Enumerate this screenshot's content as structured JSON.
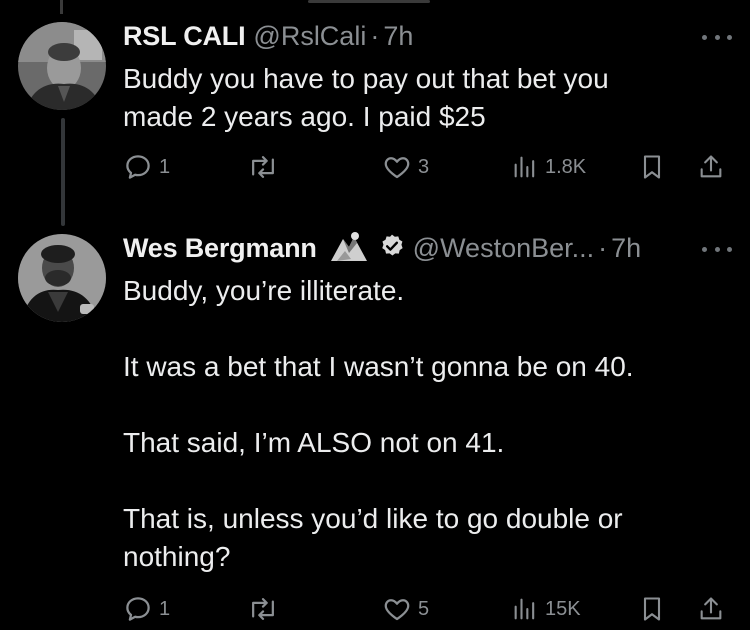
{
  "tweets": [
    {
      "name": "RSL CALI",
      "handle": "@RslCali",
      "separator": "·",
      "time": "7h",
      "text_lines": [
        "Buddy you have to pay out that bet you",
        "made 2 years ago. I paid $25"
      ],
      "actions": {
        "reply_count": "1",
        "retweet_count": "",
        "like_count": "3",
        "views_count": "1.8K"
      }
    },
    {
      "name": "Wes Bergmann",
      "handle": "@WestonBer...",
      "separator": "·",
      "time": "7h",
      "paragraphs": [
        "Buddy, you’re illiterate.",
        "It was a bet that I wasn’t gonna be on 40.",
        "That said, I’m ALSO not on 41.",
        "That is, unless you’d like to go double or nothing?"
      ],
      "actions": {
        "reply_count": "1",
        "retweet_count": "",
        "like_count": "5",
        "views_count": "15K"
      }
    }
  ],
  "colors": {
    "background": "#000000",
    "text": "#e7e9ea",
    "muted": "#8b8f93",
    "thread_line": "#333639"
  },
  "icons": [
    "reply-icon",
    "retweet-icon",
    "like-icon",
    "views-icon",
    "bookmark-icon",
    "share-icon",
    "more-icon",
    "verified-badge-icon",
    "affiliate-badge-icon"
  ]
}
